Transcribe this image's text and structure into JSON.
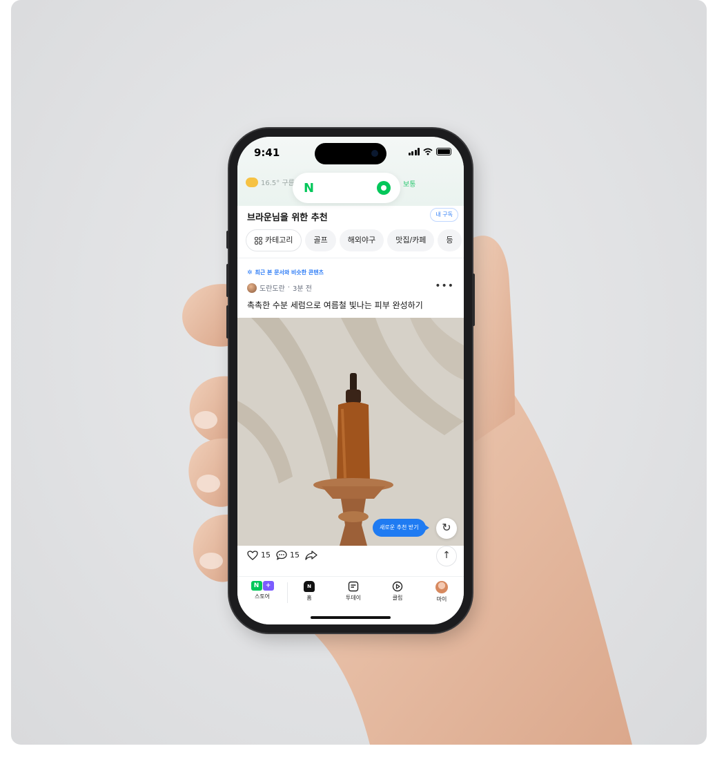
{
  "status_bar": {
    "time": "9:41"
  },
  "header": {
    "weather_text": "16.5° 구름",
    "air_quality": "보통",
    "logo_letter": "N"
  },
  "feed": {
    "section_title": "브라운님을 위한 추천",
    "subscribe_label": "내 구독",
    "categories": [
      "카테고리",
      "골프",
      "해외야구",
      "맛집/카페",
      "등"
    ]
  },
  "post": {
    "tag": "최근 본 문서와 비슷한 콘텐츠",
    "author": "도란도란",
    "time_ago": "3분 전",
    "title": "촉촉한 수분 세럼으로 여름철 빛나는 피부 완성하기",
    "likes": "15",
    "comments": "15"
  },
  "floating": {
    "new_reco_label": "새로운 추천 받기"
  },
  "tabbar": {
    "tabs": [
      {
        "label": "스토어",
        "icon": "store-icon"
      },
      {
        "label": "홈",
        "icon": "home-icon"
      },
      {
        "label": "투데이",
        "icon": "today-icon"
      },
      {
        "label": "클립",
        "icon": "clip-icon"
      },
      {
        "label": "마이",
        "icon": "my-avatar"
      }
    ],
    "store_badge_left": "N",
    "store_badge_right": "+",
    "home_badge": "N"
  },
  "colors": {
    "naver_green": "#03c75a",
    "accent_blue": "#1f7bf2",
    "store_purple": "#7b5cff"
  }
}
